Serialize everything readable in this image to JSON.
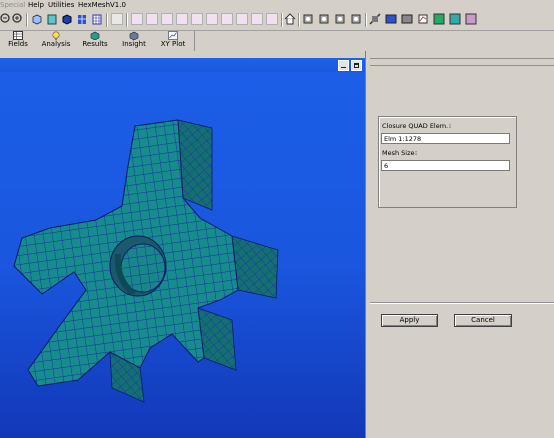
{
  "menubar": {
    "items": [
      "Special",
      "Help",
      "Utilities",
      "HexMeshV1.0"
    ]
  },
  "toolbar": {
    "icons": [
      "zoom-out-icon",
      "zoom-in-icon",
      "wire-cube-icon",
      "shaded-cube-icon",
      "solid-cube-icon",
      "grid-cube-icon",
      "mesh-view-icon",
      "align-left-icon",
      "align-right-icon",
      "node-icon",
      "element-icon",
      "edge-icon",
      "face-icon",
      "volume-icon",
      "group-icon",
      "label-icon",
      "home-icon",
      "rotate-x-icon",
      "rotate-y-icon",
      "rotate-z-icon",
      "iso-view-icon",
      "hide-icon",
      "front-view-icon",
      "render-icon",
      "plot-icon",
      "info-icon",
      "settings-icon"
    ]
  },
  "tabs": [
    {
      "label": "Fields",
      "icon": "table-icon"
    },
    {
      "label": "Analysis",
      "icon": "bulb-icon"
    },
    {
      "label": "Results",
      "icon": "results-cube-icon"
    },
    {
      "label": "Insight",
      "icon": "insight-cube-icon"
    },
    {
      "label": "XY Plot",
      "icon": "xy-plot-icon"
    }
  ],
  "panel": {
    "element_label": "Closure QUAD Elem.",
    "element_value": "Elm 1:1278",
    "mesh_size_label": "Mesh Size",
    "mesh_size_value": "6",
    "apply_label": "Apply",
    "cancel_label": "Cancel"
  },
  "colors": {
    "viewport_bg": "#1a56de",
    "mesh_fill": "#178c8c",
    "mesh_line": "#1a2aa8",
    "chrome": "#d4d0c8"
  }
}
